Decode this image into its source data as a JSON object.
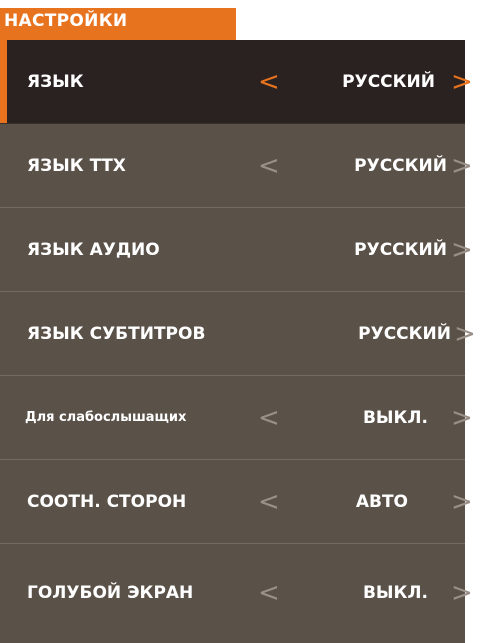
{
  "header": {
    "title": "НАСТРОЙКИ"
  },
  "colors": {
    "accent": "#e8731e",
    "row_bg": "#5a5149",
    "row_selected_bg": "#2a2220"
  },
  "settings": [
    {
      "label": "ЯЗЫК",
      "value": "РУССКИЙ",
      "left_arrow": "<",
      "right_arrow": ">"
    },
    {
      "label": "ЯЗЫК ТТХ",
      "value": "РУССКИЙ",
      "left_arrow": "<",
      "right_arrow": ">"
    },
    {
      "label": "ЯЗЫК АУДИО",
      "value": "РУССКИЙ",
      "right_arrow": ">"
    },
    {
      "label": "ЯЗЫК СУБТИТРОВ",
      "value": "РУССКИЙ",
      "right_arrow": ">"
    },
    {
      "label": "Для слабослышащих",
      "value": "ВЫКЛ.",
      "left_arrow": "<",
      "right_arrow": ">"
    },
    {
      "label": "СООТН. СТОРОН",
      "value": "АВТО",
      "left_arrow": "<",
      "right_arrow": ">"
    },
    {
      "label": "ГОЛУБОЙ ЭКРАН",
      "value": "ВЫКЛ.",
      "left_arrow": "<",
      "right_arrow": ">"
    }
  ]
}
